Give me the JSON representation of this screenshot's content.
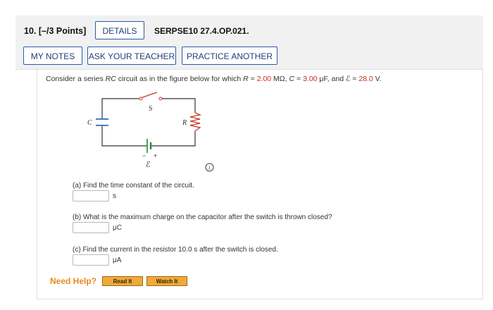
{
  "header": {
    "question_number": "10.",
    "points": "[–/3 Points]",
    "details_button": "DETAILS",
    "assignment_code": "SERPSE10 27.4.OP.021.",
    "buttons": {
      "my_notes": "MY NOTES",
      "ask_teacher": "ASK YOUR TEACHER",
      "practice_another": "PRACTICE ANOTHER"
    }
  },
  "problem": {
    "prompt_start": "Consider a series ",
    "prompt_rc": "RC",
    "prompt_mid": " circuit as in the figure below for which ",
    "r_label": "R",
    "r_eq": " = ",
    "r_value": "2.00",
    "r_unit": " MΩ, ",
    "c_label": "C",
    "c_eq": " = ",
    "c_value": "3.00",
    "c_unit": " μF, and ",
    "emf_label": "ℰ",
    "emf_eq": " = ",
    "emf_value": "28.0",
    "emf_unit": " V."
  },
  "figure": {
    "switch_label": "S",
    "capacitor_label": "C",
    "resistor_label": "R",
    "emf_label": "ℰ",
    "minus_sign": "−",
    "plus_sign": "+",
    "info_glyph": "i"
  },
  "parts": [
    {
      "question": "(a) Find the time constant of the circuit.",
      "value": "",
      "unit": "s"
    },
    {
      "question": "(b) What is the maximum charge on the capacitor after the switch is thrown closed?",
      "value": "",
      "unit": "μC"
    },
    {
      "question": "(c) Find the current in the resistor 10.0 s after the switch is closed.",
      "value": "",
      "unit": "μA"
    }
  ],
  "help": {
    "label": "Need Help?",
    "read_it": "Read It",
    "watch_it": "Watch It"
  },
  "colors": {
    "accent": "#2b5aa5",
    "highlight": "#c9281e",
    "help_orange": "#e48b1a",
    "battery_green": "#1f8a3a"
  }
}
